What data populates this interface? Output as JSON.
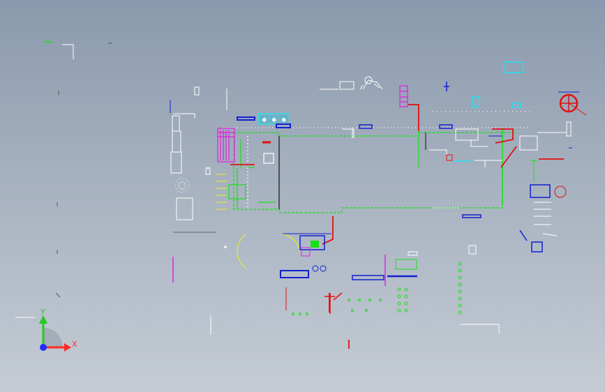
{
  "viewport": {
    "background_top": "#8a99ad",
    "background_bottom": "#c4cbd4"
  },
  "triad": {
    "x_label": "X",
    "y_label": "Y",
    "x_color": "#ff2a2a",
    "y_color": "#22cc22",
    "origin_color": "#2030ff"
  },
  "colors": {
    "green": "#18e018",
    "white": "#ffffff",
    "red": "#e01010",
    "blue": "#1020d0",
    "magenta": "#e020e0",
    "cyan": "#20e0f0",
    "yellow": "#f0f020",
    "black": "#101010"
  },
  "icons": {
    "compass": "compass-icon",
    "robot": "robot-arm-icon",
    "fan": "fan-unit-icon",
    "gear": "gear-icon"
  }
}
